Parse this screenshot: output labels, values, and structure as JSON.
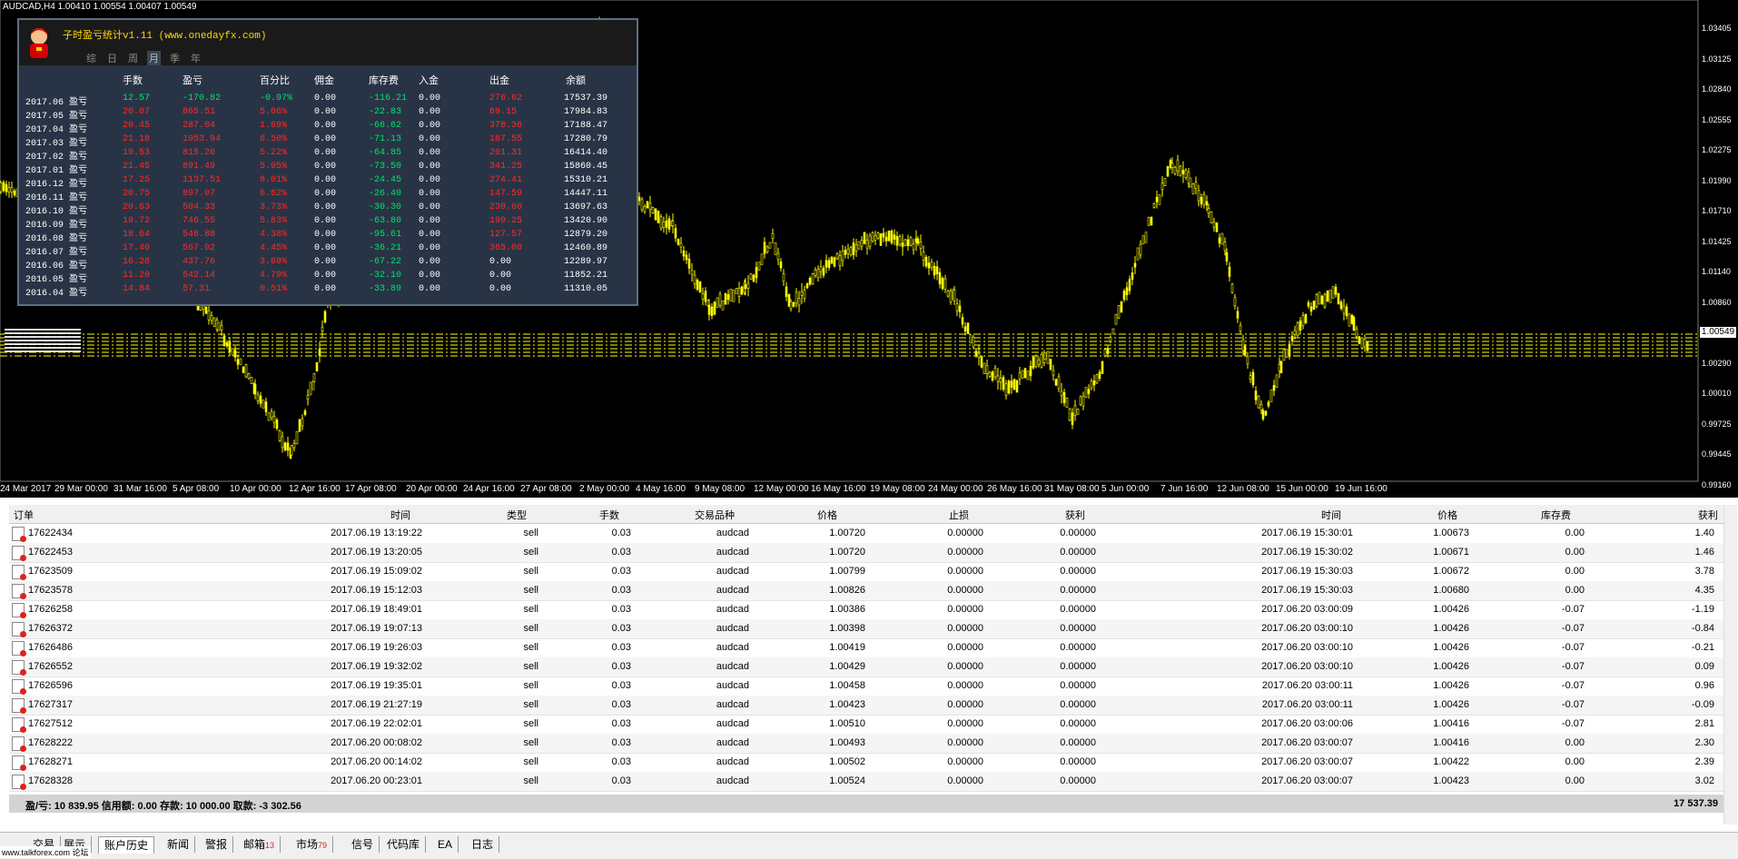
{
  "symbol_header": "AUDCAD,H4  1.00410 1.00554 1.00407 1.00549",
  "current_price": "1.00549",
  "price_ticks": [
    "1.03405",
    "1.03125",
    "1.02840",
    "1.02555",
    "1.02275",
    "1.01990",
    "1.01710",
    "1.01425",
    "1.01140",
    "1.00860",
    "1.00575",
    "1.00290",
    "1.00010",
    "0.99725",
    "0.99445",
    "0.99160"
  ],
  "time_ticks": [
    "24 Mar 2017",
    "29 Mar 00:00",
    "31 Mar 16:00",
    "5 Apr 08:00",
    "10 Apr 00:00",
    "12 Apr 16:00",
    "17 Apr 08:00",
    "20 Apr 00:00",
    "24 Apr 16:00",
    "27 Apr 08:00",
    "2 May 00:00",
    "4 May 16:00",
    "9 May 08:00",
    "12 May 00:00",
    "16 May 16:00",
    "19 May 08:00",
    "24 May 00:00",
    "26 May 16:00",
    "31 May 08:00",
    "5 Jun 00:00",
    "7 Jun 16:00",
    "12 Jun 08:00",
    "15 Jun 00:00",
    "19 Jun 16:00"
  ],
  "stats": {
    "title": "子时盈亏统计v1.11 (www.onedayfx.com)",
    "tabs": [
      "综",
      "日",
      "周",
      "月",
      "季",
      "年"
    ],
    "headers": [
      "手数",
      "盈亏",
      "百分比",
      "佣金",
      "库存费",
      "入金",
      "出金",
      "余额"
    ],
    "rows": [
      {
        "period": "2017.06 盈亏",
        "lots": "12.57",
        "pnl": "-170.82",
        "pct": "-0.97%",
        "comm": "0.00",
        "swap": "-116.21",
        "dep": "0.00",
        "wd": "276.62",
        "bal": "17537.39",
        "c": "g"
      },
      {
        "period": "2017.05 盈亏",
        "lots": "20.07",
        "pnl": "865.51",
        "pct": "5.06%",
        "comm": "0.00",
        "swap": "-22.83",
        "dep": "0.00",
        "wd": "69.15",
        "bal": "17984.83",
        "c": "r"
      },
      {
        "period": "2017.04 盈亏",
        "lots": "20.45",
        "pnl": "287.04",
        "pct": "1.69%",
        "comm": "0.00",
        "swap": "-66.62",
        "dep": "0.00",
        "wd": "378.36",
        "bal": "17188.47",
        "c": "r"
      },
      {
        "period": "2017.03 盈亏",
        "lots": "21.18",
        "pnl": "1053.94",
        "pct": "6.50%",
        "comm": "0.00",
        "swap": "-71.13",
        "dep": "0.00",
        "wd": "187.55",
        "bal": "17280.79",
        "c": "r"
      },
      {
        "period": "2017.02 盈亏",
        "lots": "19.53",
        "pnl": "815.26",
        "pct": "5.22%",
        "comm": "0.00",
        "swap": "-64.85",
        "dep": "0.00",
        "wd": "201.31",
        "bal": "16414.40",
        "c": "r"
      },
      {
        "period": "2017.01 盈亏",
        "lots": "21.45",
        "pnl": "891.49",
        "pct": "5.95%",
        "comm": "0.00",
        "swap": "-73.50",
        "dep": "0.00",
        "wd": "341.25",
        "bal": "15860.45",
        "c": "r"
      },
      {
        "period": "2016.12 盈亏",
        "lots": "17.25",
        "pnl": "1137.51",
        "pct": "8.01%",
        "comm": "0.00",
        "swap": "-24.45",
        "dep": "0.00",
        "wd": "274.41",
        "bal": "15310.21",
        "c": "r"
      },
      {
        "period": "2016.11 盈亏",
        "lots": "20.75",
        "pnl": "897.07",
        "pct": "6.62%",
        "comm": "0.00",
        "swap": "-26.40",
        "dep": "0.00",
        "wd": "147.59",
        "bal": "14447.11",
        "c": "r"
      },
      {
        "period": "2016.10 盈亏",
        "lots": "20.63",
        "pnl": "504.33",
        "pct": "3.73%",
        "comm": "0.00",
        "swap": "-30.30",
        "dep": "0.00",
        "wd": "230.60",
        "bal": "13697.63",
        "c": "r"
      },
      {
        "period": "2016.09 盈亏",
        "lots": "19.72",
        "pnl": "746.55",
        "pct": "5.83%",
        "comm": "0.00",
        "swap": "-63.80",
        "dep": "0.00",
        "wd": "199.25",
        "bal": "13420.90",
        "c": "r"
      },
      {
        "period": "2016.08 盈亏",
        "lots": "18.64",
        "pnl": "546.88",
        "pct": "4.38%",
        "comm": "0.00",
        "swap": "-95.61",
        "dep": "0.00",
        "wd": "127.57",
        "bal": "12879.20",
        "c": "r"
      },
      {
        "period": "2016.07 盈亏",
        "lots": "17.40",
        "pnl": "567.92",
        "pct": "4.45%",
        "comm": "0.00",
        "swap": "-36.21",
        "dep": "0.00",
        "wd": "365.00",
        "bal": "12460.89",
        "c": "r"
      },
      {
        "period": "2016.06 盈亏",
        "lots": "16.28",
        "pnl": "437.76",
        "pct": "3.69%",
        "comm": "0.00",
        "swap": "-67.22",
        "dep": "0.00",
        "wd": "0.00",
        "bal": "12289.97",
        "c": "r"
      },
      {
        "period": "2016.05 盈亏",
        "lots": "11.20",
        "pnl": "542.14",
        "pct": "4.79%",
        "comm": "0.00",
        "swap": "-32.10",
        "dep": "0.00",
        "wd": "0.00",
        "bal": "11852.21",
        "c": "r"
      },
      {
        "period": "2016.04 盈亏",
        "lots": "14.84",
        "pnl": "57.31",
        "pct": "0.51%",
        "comm": "0.00",
        "swap": "-33.89",
        "dep": "0.00",
        "wd": "0.00",
        "bal": "11310.05",
        "c": "r"
      }
    ]
  },
  "table": {
    "headers": [
      "订单",
      "时间",
      "类型",
      "手数",
      "交易品种",
      "价格",
      "止损",
      "获利",
      "时间",
      "价格",
      "库存费",
      "获利"
    ],
    "rows": [
      [
        "17622434",
        "2017.06.19 13:19:22",
        "sell",
        "0.03",
        "audcad",
        "1.00720",
        "0.00000",
        "0.00000",
        "2017.06.19 15:30:01",
        "1.00673",
        "0.00",
        "1.40"
      ],
      [
        "17622453",
        "2017.06.19 13:20:05",
        "sell",
        "0.03",
        "audcad",
        "1.00720",
        "0.00000",
        "0.00000",
        "2017.06.19 15:30:02",
        "1.00671",
        "0.00",
        "1.46"
      ],
      [
        "17623509",
        "2017.06.19 15:09:02",
        "sell",
        "0.03",
        "audcad",
        "1.00799",
        "0.00000",
        "0.00000",
        "2017.06.19 15:30:03",
        "1.00672",
        "0.00",
        "3.78"
      ],
      [
        "17623578",
        "2017.06.19 15:12:03",
        "sell",
        "0.03",
        "audcad",
        "1.00826",
        "0.00000",
        "0.00000",
        "2017.06.19 15:30:03",
        "1.00680",
        "0.00",
        "4.35"
      ],
      [
        "17626258",
        "2017.06.19 18:49:01",
        "sell",
        "0.03",
        "audcad",
        "1.00386",
        "0.00000",
        "0.00000",
        "2017.06.20 03:00:09",
        "1.00426",
        "-0.07",
        "-1.19"
      ],
      [
        "17626372",
        "2017.06.19 19:07:13",
        "sell",
        "0.03",
        "audcad",
        "1.00398",
        "0.00000",
        "0.00000",
        "2017.06.20 03:00:10",
        "1.00426",
        "-0.07",
        "-0.84"
      ],
      [
        "17626486",
        "2017.06.19 19:26:03",
        "sell",
        "0.03",
        "audcad",
        "1.00419",
        "0.00000",
        "0.00000",
        "2017.06.20 03:00:10",
        "1.00426",
        "-0.07",
        "-0.21"
      ],
      [
        "17626552",
        "2017.06.19 19:32:02",
        "sell",
        "0.03",
        "audcad",
        "1.00429",
        "0.00000",
        "0.00000",
        "2017.06.20 03:00:10",
        "1.00426",
        "-0.07",
        "0.09"
      ],
      [
        "17626596",
        "2017.06.19 19:35:01",
        "sell",
        "0.03",
        "audcad",
        "1.00458",
        "0.00000",
        "0.00000",
        "2017.06.20 03:00:11",
        "1.00426",
        "-0.07",
        "0.96"
      ],
      [
        "17627317",
        "2017.06.19 21:27:19",
        "sell",
        "0.03",
        "audcad",
        "1.00423",
        "0.00000",
        "0.00000",
        "2017.06.20 03:00:11",
        "1.00426",
        "-0.07",
        "-0.09"
      ],
      [
        "17627512",
        "2017.06.19 22:02:01",
        "sell",
        "0.03",
        "audcad",
        "1.00510",
        "0.00000",
        "0.00000",
        "2017.06.20 03:00:06",
        "1.00416",
        "-0.07",
        "2.81"
      ],
      [
        "17628222",
        "2017.06.20 00:08:02",
        "sell",
        "0.03",
        "audcad",
        "1.00493",
        "0.00000",
        "0.00000",
        "2017.06.20 03:00:07",
        "1.00416",
        "0.00",
        "2.30"
      ],
      [
        "17628271",
        "2017.06.20 00:14:02",
        "sell",
        "0.03",
        "audcad",
        "1.00502",
        "0.00000",
        "0.00000",
        "2017.06.20 03:00:07",
        "1.00422",
        "0.00",
        "2.39"
      ],
      [
        "17628328",
        "2017.06.20 00:23:01",
        "sell",
        "0.03",
        "audcad",
        "1.00524",
        "0.00000",
        "0.00000",
        "2017.06.20 03:00:07",
        "1.00423",
        "0.00",
        "3.02"
      ]
    ],
    "summary": "盈/亏: 10 839.95  信用额: 0.00  存款: 10 000.00  取款: -3 302.56",
    "total": "17 537.39"
  },
  "bottom_tabs": [
    {
      "label": "交易"
    },
    {
      "label": "展示"
    },
    {
      "label": "账户历史",
      "selected": true
    },
    {
      "label": "新闻"
    },
    {
      "label": "警报"
    },
    {
      "label": "邮箱",
      "badge": "13"
    },
    {
      "label": "市场",
      "badge": "79"
    },
    {
      "label": "信号"
    },
    {
      "label": "代码库"
    },
    {
      "label": "EA"
    },
    {
      "label": "日志"
    }
  ],
  "footer_link": "www.talkforex.com 论坛",
  "colors": {
    "candle": "#ffff00",
    "profit_green": "#00e36a",
    "loss_red": "#ff2a2a",
    "panel": "#283445"
  }
}
